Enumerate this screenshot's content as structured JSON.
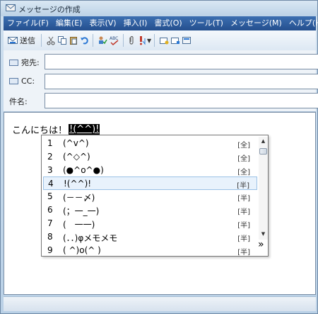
{
  "window": {
    "title": "メッセージの作成"
  },
  "menu": [
    "ファイル(F)",
    "編集(E)",
    "表示(V)",
    "挿入(I)",
    "書式(O)",
    "ツール(T)",
    "メッセージ(M)",
    "ヘルプ(H)"
  ],
  "toolbar": {
    "send_label": "送信",
    "icons": [
      "send-icon",
      "cut-icon",
      "copy-icon",
      "paste-icon",
      "undo-icon",
      "check-names-icon",
      "spelling-icon",
      "attach-icon",
      "priority-icon",
      "sign-icon",
      "encrypt-icon",
      "offline-icon"
    ]
  },
  "headers": {
    "to_label": "宛先:",
    "cc_label": "CC:",
    "subject_label": "件名:",
    "to_value": "",
    "cc_value": "",
    "subject_value": ""
  },
  "body": {
    "text": "こんにちは！",
    "composing": "!(^^)!"
  },
  "ime": {
    "candidates": [
      {
        "num": "1",
        "text": "(^v^)",
        "width": "[全]"
      },
      {
        "num": "2",
        "text": "(^◇^)",
        "width": "[全]"
      },
      {
        "num": "3",
        "text": "(●^o^●)",
        "width": "[全]"
      },
      {
        "num": "4",
        "text": "!(^^)!",
        "width": "[半]"
      },
      {
        "num": "5",
        "text": "(－－〆)",
        "width": "[半]"
      },
      {
        "num": "6",
        "text": "(；一_一)",
        "width": "[半]"
      },
      {
        "num": "7",
        "text": "(　一一)",
        "width": "[半]"
      },
      {
        "num": "8",
        "text": "(．．)φメモメモ",
        "width": "[半]"
      },
      {
        "num": "9",
        "text": "( ^)o(^ )",
        "width": "[半]"
      }
    ],
    "selected_index": 4,
    "expand_glyph": "»",
    "scroll_up": "▲",
    "scroll_down": "▼"
  },
  "colors": {
    "menubar": "#244f8e",
    "selection": "#e8f2fc",
    "selection_border": "#9bc1e6"
  }
}
